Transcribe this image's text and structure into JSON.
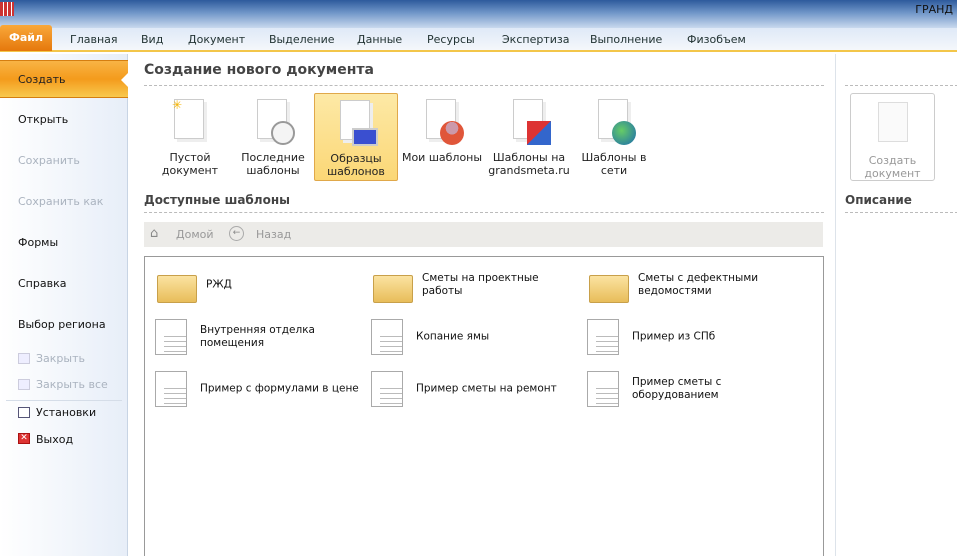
{
  "window": {
    "title": "ГРАНД"
  },
  "ribbon": {
    "file_tab": "Файл",
    "tabs": [
      "Главная",
      "Вид",
      "Документ",
      "Выделение",
      "Данные",
      "Ресурсы",
      "Экспертиза",
      "Выполнение",
      "Физобъем"
    ]
  },
  "sidebar": {
    "items": [
      {
        "label": "Создать"
      },
      {
        "label": "Открыть"
      },
      {
        "label": "Сохранить"
      },
      {
        "label": "Сохранить как"
      },
      {
        "label": "Формы"
      },
      {
        "label": "Справка"
      },
      {
        "label": "Выбор региона"
      },
      {
        "label": "Закрыть"
      },
      {
        "label": "Закрыть все"
      },
      {
        "label": "Установки"
      },
      {
        "label": "Выход"
      }
    ]
  },
  "main": {
    "title": "Создание нового документа",
    "template_buttons": [
      {
        "line1": "Пустой",
        "line2": "документ"
      },
      {
        "line1": "Последние",
        "line2": "шаблоны"
      },
      {
        "line1": "Образцы",
        "line2": "шаблонов"
      },
      {
        "line1": "Мои шаблоны",
        "line2": ""
      },
      {
        "line1": "Шаблоны на",
        "line2": "grandsmeta.ru"
      },
      {
        "line1": "Шаблоны в",
        "line2": "сети"
      }
    ],
    "available_title": "Доступные шаблоны",
    "nav": {
      "home": "Домой",
      "back": "Назад"
    },
    "items": [
      "РЖД",
      "Сметы на проектные работы",
      "Сметы с дефектными ведомостями",
      "Внутренняя отделка помещения",
      "Копание ямы",
      "Пример из СПб",
      "Пример с формулами в цене",
      "Пример сметы на ремонт",
      "Пример сметы с оборудованием"
    ]
  },
  "right": {
    "create_line1": "Создать",
    "create_line2": "документ",
    "description": "Описание"
  }
}
